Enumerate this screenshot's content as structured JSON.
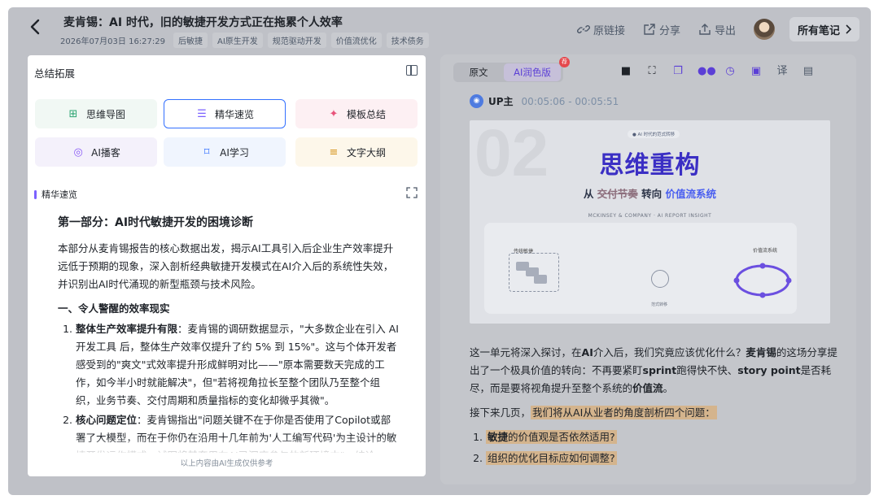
{
  "header": {
    "title": "麦肯锡：AI 时代，旧的敏捷开发方式正在拖累个人效率",
    "date": "2026年07月03日 16:27:29",
    "tags": [
      "后敏捷",
      "AI原生开发",
      "规范驱动开发",
      "价值流优化",
      "技术债务"
    ],
    "actions": {
      "source_link": "原链接",
      "share": "分享",
      "export": "导出",
      "all_notes": "所有笔记"
    }
  },
  "left_panel": {
    "title": "总结拓展",
    "tools": [
      {
        "label": "思维导图",
        "icon": "mindmap-icon"
      },
      {
        "label": "精华速览",
        "icon": "highlights-icon",
        "selected": true
      },
      {
        "label": "模板总结",
        "icon": "template-icon"
      },
      {
        "label": "AI播客",
        "icon": "podcast-icon"
      },
      {
        "label": "AI学习",
        "icon": "learning-icon"
      },
      {
        "label": "文字大纲",
        "icon": "outline-icon"
      }
    ],
    "section_label": "精华速览",
    "article": {
      "heading": "第一部分：AI时代敏捷开发的困境诊断",
      "intro": "本部分从麦肯锡报告的核心数据出发，揭示AI工具引入后企业生产效率提升远低于预期的现象，深入剖析经典敏捷开发模式在AI介入后的系统性失效，并识别出AI时代涌现的新型瓶颈与技术风险。",
      "subheading": "一、令人警醒的效率现实",
      "items": [
        {
          "bold": "整体生产效率提升有限",
          "text": "：麦肯锡的调研数据显示，\"大多数企业在引入 AI 开发工具 后，整体生产效率仅提升了约 5% 到 15%\"。这与个体开发者感受到的\"爽文\"式效率提升形成鲜明对比——\"原本需要数天完成的工作，如今半小时就能解决\"，但\"若将视角拉长至整个团队乃至整个组织，业务节奏、交付周期和质量指标的变化却微乎其微\"。"
        },
        {
          "bold": "核心问题定位",
          "text": "：麦肯锡指出\"问题关键不在于你是否使用了Copilot或部署了大模型，而在于你仍在沿用十几年前为'人工编写代码'为主设计的敏捷开发运作模式，试图将其套用在AI已深度参与的新环境中\"。结论"
        }
      ]
    },
    "footnote": "以上内容由AI生成仅供参考"
  },
  "right_panel": {
    "tabs": [
      "原文",
      "AI润色版"
    ],
    "active_tab": "AI润色版",
    "badge": "荐",
    "speaker": "UP主",
    "time_range": "00:05:06 - 00:05:51",
    "slide": {
      "number": "02",
      "chip": "● AI 时代的范式转移",
      "title": "思维重构",
      "sub_prefix": "从 ",
      "sub_strike": "交付节奏",
      "sub_mid": " 转向 ",
      "sub_highlight": "价值流系统",
      "tagline": "MCKINSEY & COMPANY · AI REPORT INSIGHT",
      "left_label": "传统敏捷",
      "right_label": "价值流系统",
      "mid_label": "范式转移"
    },
    "paragraph1_a": "这一单元将深入探讨，在",
    "paragraph1_b": "AI",
    "paragraph1_c": "介入后，我们究竟应该优化什么？",
    "paragraph1_d": "麦肯锡",
    "paragraph1_e": "的这场分享提出了一个极具价值的转向：不再要紧盯",
    "paragraph1_f": "sprint",
    "paragraph1_g": "跑得快不快、",
    "paragraph1_h": "story point",
    "paragraph1_i": "是否耗尽，而是要将视角提升至整个系统的",
    "paragraph1_j": "价值流",
    "paragraph1_k": "。",
    "paragraph2_prefix": "接下来几页，",
    "paragraph2_highlight": "我们将从AI从业者的角度剖析四个问题：",
    "questions": [
      {
        "bold": "敏捷",
        "text": "的价值观是否依然适用?"
      },
      {
        "bold": "",
        "text": "组织的优化目标应如何调整?"
      }
    ],
    "colors": {
      "accent": "#5b3fd6",
      "highlight": "#d4b48d",
      "slide_title": "#3b2fc4"
    }
  }
}
